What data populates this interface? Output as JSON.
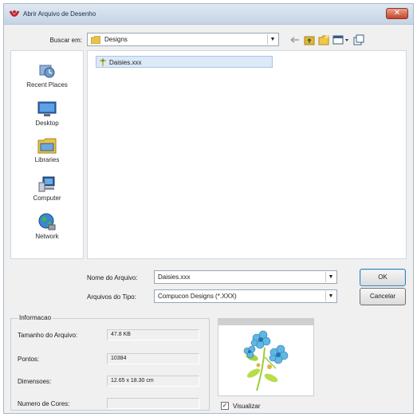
{
  "window": {
    "title": "Abrir Arquivo de Desenho",
    "close_icon": "close-icon"
  },
  "toolbar": {
    "look_in_label": "Buscar em:",
    "look_in_value": "Designs",
    "icons": [
      "back-arrow-icon",
      "up-folder-icon",
      "new-folder-icon",
      "view-menu-icon",
      "tools-icon"
    ]
  },
  "places": [
    {
      "label": "Recent Places",
      "icon": "recent-places-icon"
    },
    {
      "label": "Desktop",
      "icon": "desktop-icon"
    },
    {
      "label": "Libraries",
      "icon": "libraries-icon"
    },
    {
      "label": "Computer",
      "icon": "computer-icon"
    },
    {
      "label": "Network",
      "icon": "network-icon"
    }
  ],
  "files": [
    {
      "name": "Daisies.xxx",
      "icon": "design-file-icon"
    }
  ],
  "form": {
    "filename_label": "Nome do Arquivo:",
    "filename_value": "Daisies.xxx",
    "filetype_label": "Arquivos do Tipo:",
    "filetype_value": "Compucon Designs (*.XXX)"
  },
  "buttons": {
    "ok": "OK",
    "cancel": "Cancelar"
  },
  "info": {
    "title": "Informacao",
    "file_size_label": "Tamanho do Arquivo:",
    "file_size_value": "47.8 KB",
    "points_label": "Pontos:",
    "points_value": "10384",
    "dimensions_label": "Dimensoes:",
    "dimensions_value": "12.65 x 18.30 cm",
    "colors_label": "Numero de Cores:",
    "colors_value": ""
  },
  "preview": {
    "checkbox_label": "Visualizar",
    "checked": true
  },
  "colors": {
    "title_bar": "#c5d4e4",
    "selection": "#dce9f7",
    "close_button": "#c8452b"
  }
}
